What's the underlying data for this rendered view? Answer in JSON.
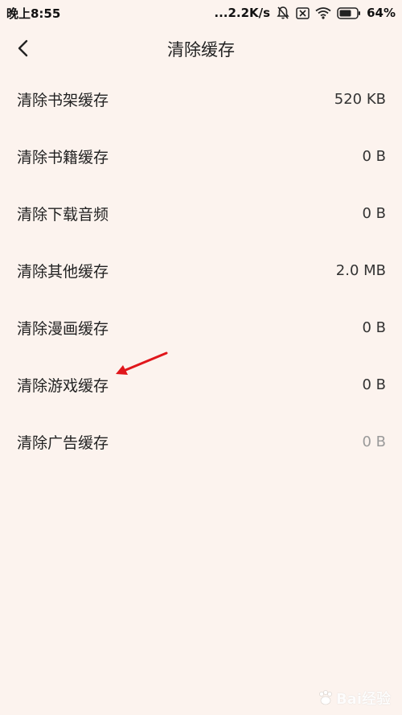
{
  "status_bar": {
    "time": "晚上8:55",
    "network_speed": "...2.2K/s",
    "battery": "64%"
  },
  "header": {
    "title": "清除缓存",
    "back_icon": "back-chevron-icon"
  },
  "cache_items": [
    {
      "label": "清除书架缓存",
      "value": "520 KB"
    },
    {
      "label": "清除书籍缓存",
      "value": "0 B"
    },
    {
      "label": "清除下载音频",
      "value": "0 B"
    },
    {
      "label": "清除其他缓存",
      "value": "2.0 MB"
    },
    {
      "label": "清除漫画缓存",
      "value": "0 B"
    },
    {
      "label": "清除游戏缓存",
      "value": "0 B"
    },
    {
      "label": "清除广告缓存",
      "value": "0 B",
      "muted": true
    }
  ],
  "annotation": {
    "color": "#e0161b"
  },
  "watermark": {
    "text": "Bai经验"
  },
  "colors": {
    "background": "#fcf3ee",
    "text": "#222222",
    "muted": "#9a9a9a"
  }
}
